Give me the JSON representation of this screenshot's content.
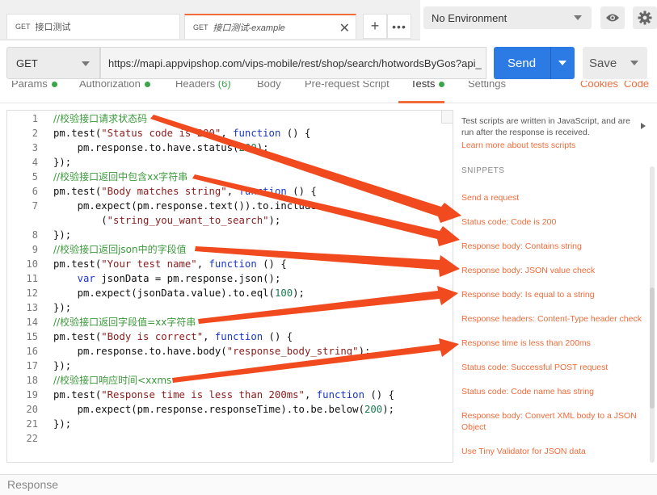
{
  "tabs": [
    {
      "method": "GET",
      "name": "接口测试"
    },
    {
      "method": "GET",
      "name": "接口测试-example"
    }
  ],
  "environment": {
    "selected": "No Environment"
  },
  "request": {
    "method": "GET",
    "url": "https://mapi.appvipshop.com/vips-mobile/rest/shop/search/hotwordsByGos?api_",
    "send_label": "Send",
    "save_label": "Save"
  },
  "subtabs": {
    "params": "Params",
    "authorization": "Authorization",
    "headers": "Headers",
    "headers_count": "(6)",
    "body": "Body",
    "prerequest": "Pre-request Script",
    "tests": "Tests",
    "settings": "Settings",
    "cookies": "Cookies",
    "code": "Code"
  },
  "code_lines": [
    {
      "n": "1",
      "comment": "//校验接口请求状态码"
    },
    {
      "n": "2",
      "pre": "pm.test(",
      "str": "\"Status code is 200\"",
      "mid": ", ",
      "kw": "function",
      "post": " () {"
    },
    {
      "n": "3",
      "pre": "    pm.response.to.have.status(",
      "num": "200",
      "post": ");"
    },
    {
      "n": "4",
      "pre": "});"
    },
    {
      "n": "5",
      "comment": "//校验接口返回中包含xx字符串"
    },
    {
      "n": "6",
      "pre": "pm.test(",
      "str": "\"Body matches string\"",
      "mid": ", ",
      "kw": "function",
      "post": " () {"
    },
    {
      "n": "7",
      "pre": "    pm.expect(pm.response.text()).to.include"
    },
    {
      "n": "",
      "pre": "        (",
      "str": "\"string_you_want_to_search\"",
      "post": ");"
    },
    {
      "n": "8",
      "pre": "});"
    },
    {
      "n": "9",
      "comment": "//校验接口返回json中的字段值"
    },
    {
      "n": "10",
      "pre": "pm.test(",
      "str": "\"Your test name\"",
      "mid": ", ",
      "kw": "function",
      "post": " () {"
    },
    {
      "n": "11",
      "pre": "    ",
      "kw": "var",
      "post": " jsonData = pm.response.json();"
    },
    {
      "n": "12",
      "pre": "    pm.expect(jsonData.value).to.eql(",
      "num": "100",
      "post": ");"
    },
    {
      "n": "13",
      "pre": "});"
    },
    {
      "n": "14",
      "comment": "//校验接口返回字段值=xx字符串"
    },
    {
      "n": "15",
      "pre": "pm.test(",
      "str": "\"Body is correct\"",
      "mid": ", ",
      "kw": "function",
      "post": " () {"
    },
    {
      "n": "16",
      "pre": "    pm.response.to.have.body(",
      "str": "\"response_body_string\"",
      "post": ");"
    },
    {
      "n": "17",
      "pre": "});"
    },
    {
      "n": "18",
      "comment": "//校验接口响应时间<xxms"
    },
    {
      "n": "19",
      "pre": "pm.test(",
      "str": "\"Response time is less than 200ms\"",
      "mid": ", ",
      "kw": "function",
      "post": " () {"
    },
    {
      "n": "20",
      "pre": "    pm.expect(pm.response.responseTime).to.be.below(",
      "num": "200",
      "post": ");"
    },
    {
      "n": "21",
      "pre": "});"
    },
    {
      "n": "22",
      "pre": ""
    }
  ],
  "side_panel": {
    "description": "Test scripts are written in JavaScript, and are run after the response is received.",
    "learn_more": "Learn more about tests scripts",
    "snippets_heading": "SNIPPETS",
    "snippets": [
      "Send a request",
      "Status code: Code is 200",
      "Response body: Contains string",
      "Response body: JSON value check",
      "Response body: Is equal to a string",
      "Response headers: Content-Type header check",
      "Response time is less than 200ms",
      "Status code: Successful POST request",
      "Status code: Code name has string",
      "Response body: Convert XML body to a JSON Object",
      "Use Tiny Validator for JSON data"
    ]
  },
  "response": {
    "label": "Response"
  },
  "colors": {
    "accent": "#f26b3a",
    "send": "#2c7be5",
    "arrow": "#f04a1e",
    "comment": "#3a9a3a"
  }
}
